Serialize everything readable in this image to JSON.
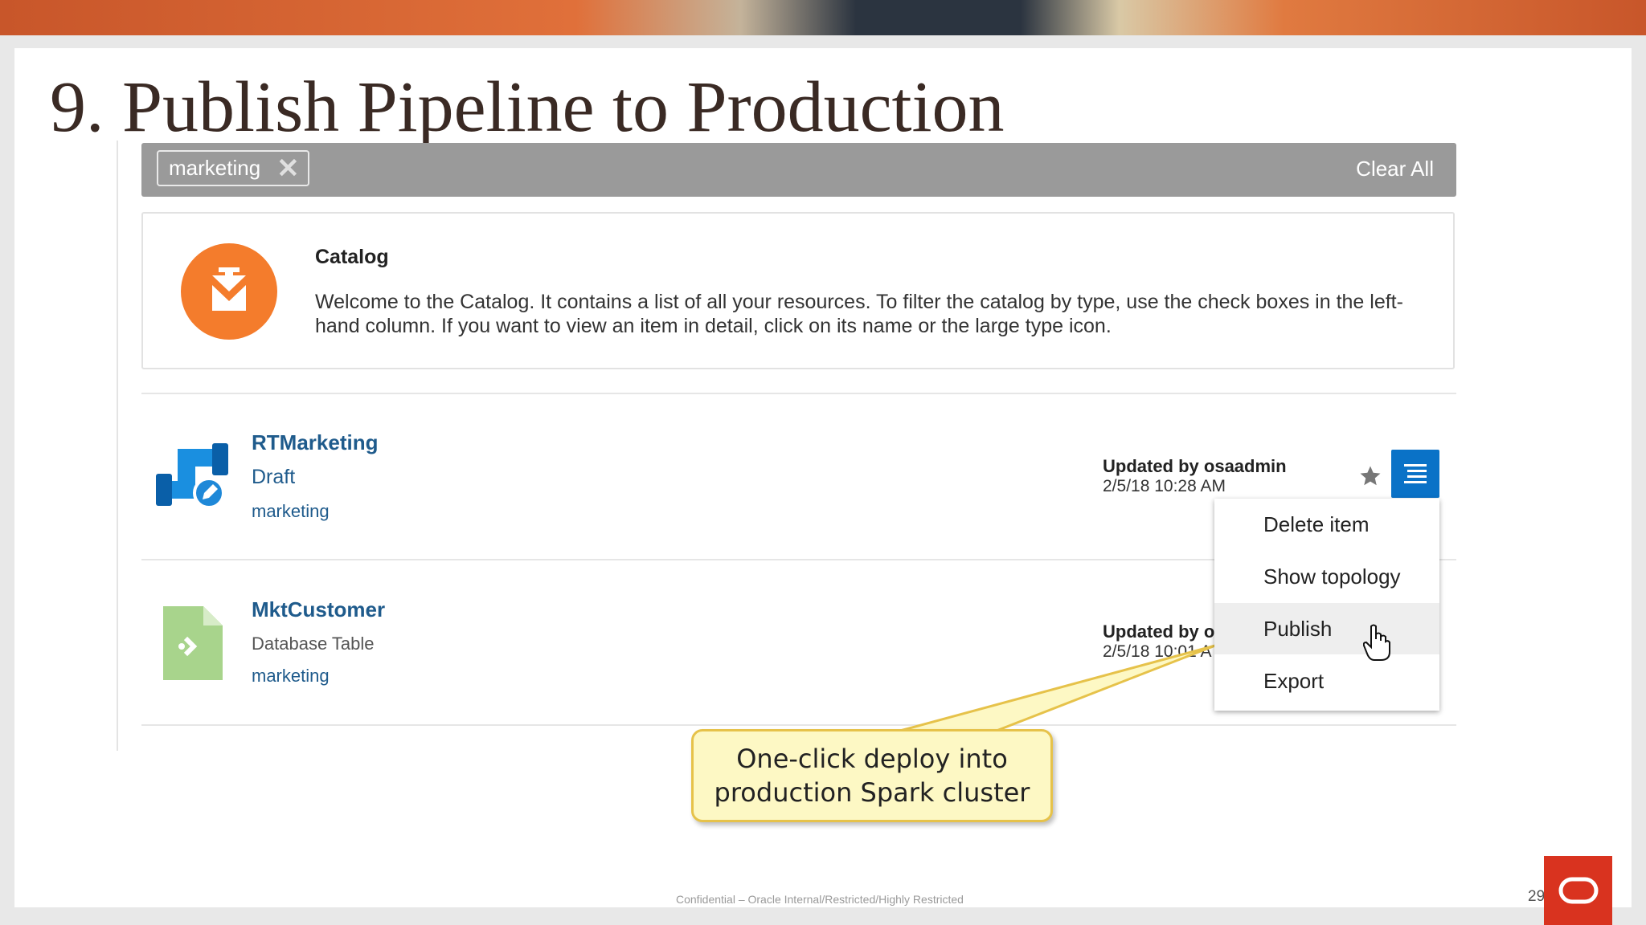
{
  "slide": {
    "title": "9. Publish Pipeline to Production",
    "footer": "Confidential – Oracle Internal/Restricted/Highly Restricted",
    "page_number": "29"
  },
  "filter_bar": {
    "chip_label": "marketing",
    "clear_all": "Clear All"
  },
  "catalog": {
    "title": "Catalog",
    "description": "Welcome to the Catalog. It contains a list of all your resources. To filter the catalog by type, use the check boxes in the left-hand column. If you want to view an item in detail, click on its name or the large type icon.",
    "icon": "catalog-icon",
    "icon_color": "#f47c2c"
  },
  "items": [
    {
      "name": "RTMarketing",
      "type": "Draft",
      "tag": "marketing",
      "updated_by": "Updated by osaadmin",
      "updated_time": "2/5/18 10:28 AM",
      "icon": "pipeline-icon"
    },
    {
      "name": "MktCustomer",
      "type": "Database Table",
      "tag": "marketing",
      "updated_by": "Updated by o",
      "updated_time": "2/5/18 10:01 A",
      "icon": "database-table-icon"
    }
  ],
  "menu": {
    "items": [
      "Delete item",
      "Show topology",
      "Publish",
      "Export"
    ],
    "active": "Publish"
  },
  "callout": {
    "line1": "One-click deploy into",
    "line2": "production Spark cluster"
  },
  "colors": {
    "accent_blue": "#0a72c7",
    "link_blue": "#1f5b8c",
    "oracle_red": "#d9331f",
    "callout_fill": "#fdf8c4"
  }
}
